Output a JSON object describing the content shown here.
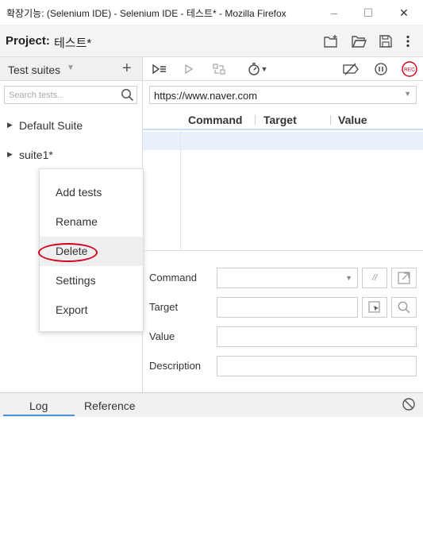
{
  "window": {
    "title": "확장기능: (Selenium IDE) - Selenium IDE - 테스트* - Mozilla Firefox",
    "minimize": "–",
    "maximize": "☐",
    "close": "✕"
  },
  "project": {
    "label": "Project:",
    "name": "테스트*"
  },
  "sidebar": {
    "header": "Test suites",
    "add_symbol": "+",
    "search_placeholder": "Search tests...",
    "suites": [
      {
        "name": "Default Suite"
      },
      {
        "name": "suite1*"
      }
    ]
  },
  "context_menu": {
    "items": [
      {
        "label": "Add tests"
      },
      {
        "label": "Rename"
      },
      {
        "label": "Delete"
      },
      {
        "label": "Settings"
      },
      {
        "label": "Export"
      }
    ]
  },
  "toolbar": {
    "rec_label": "REC"
  },
  "url": {
    "value": "https://www.naver.com"
  },
  "table": {
    "headers": [
      "Command",
      "Target",
      "Value"
    ]
  },
  "editor": {
    "command_label": "Command",
    "target_label": "Target",
    "value_label": "Value",
    "description_label": "Description",
    "comment_symbol": "//"
  },
  "bottom_tabs": [
    {
      "label": "Log"
    },
    {
      "label": "Reference"
    }
  ],
  "colors": {
    "highlight_oval": "#d0021b",
    "rec_red": "#d0021b",
    "tab_underline": "#4a90d9",
    "selected_row": "#e8f1fb"
  }
}
